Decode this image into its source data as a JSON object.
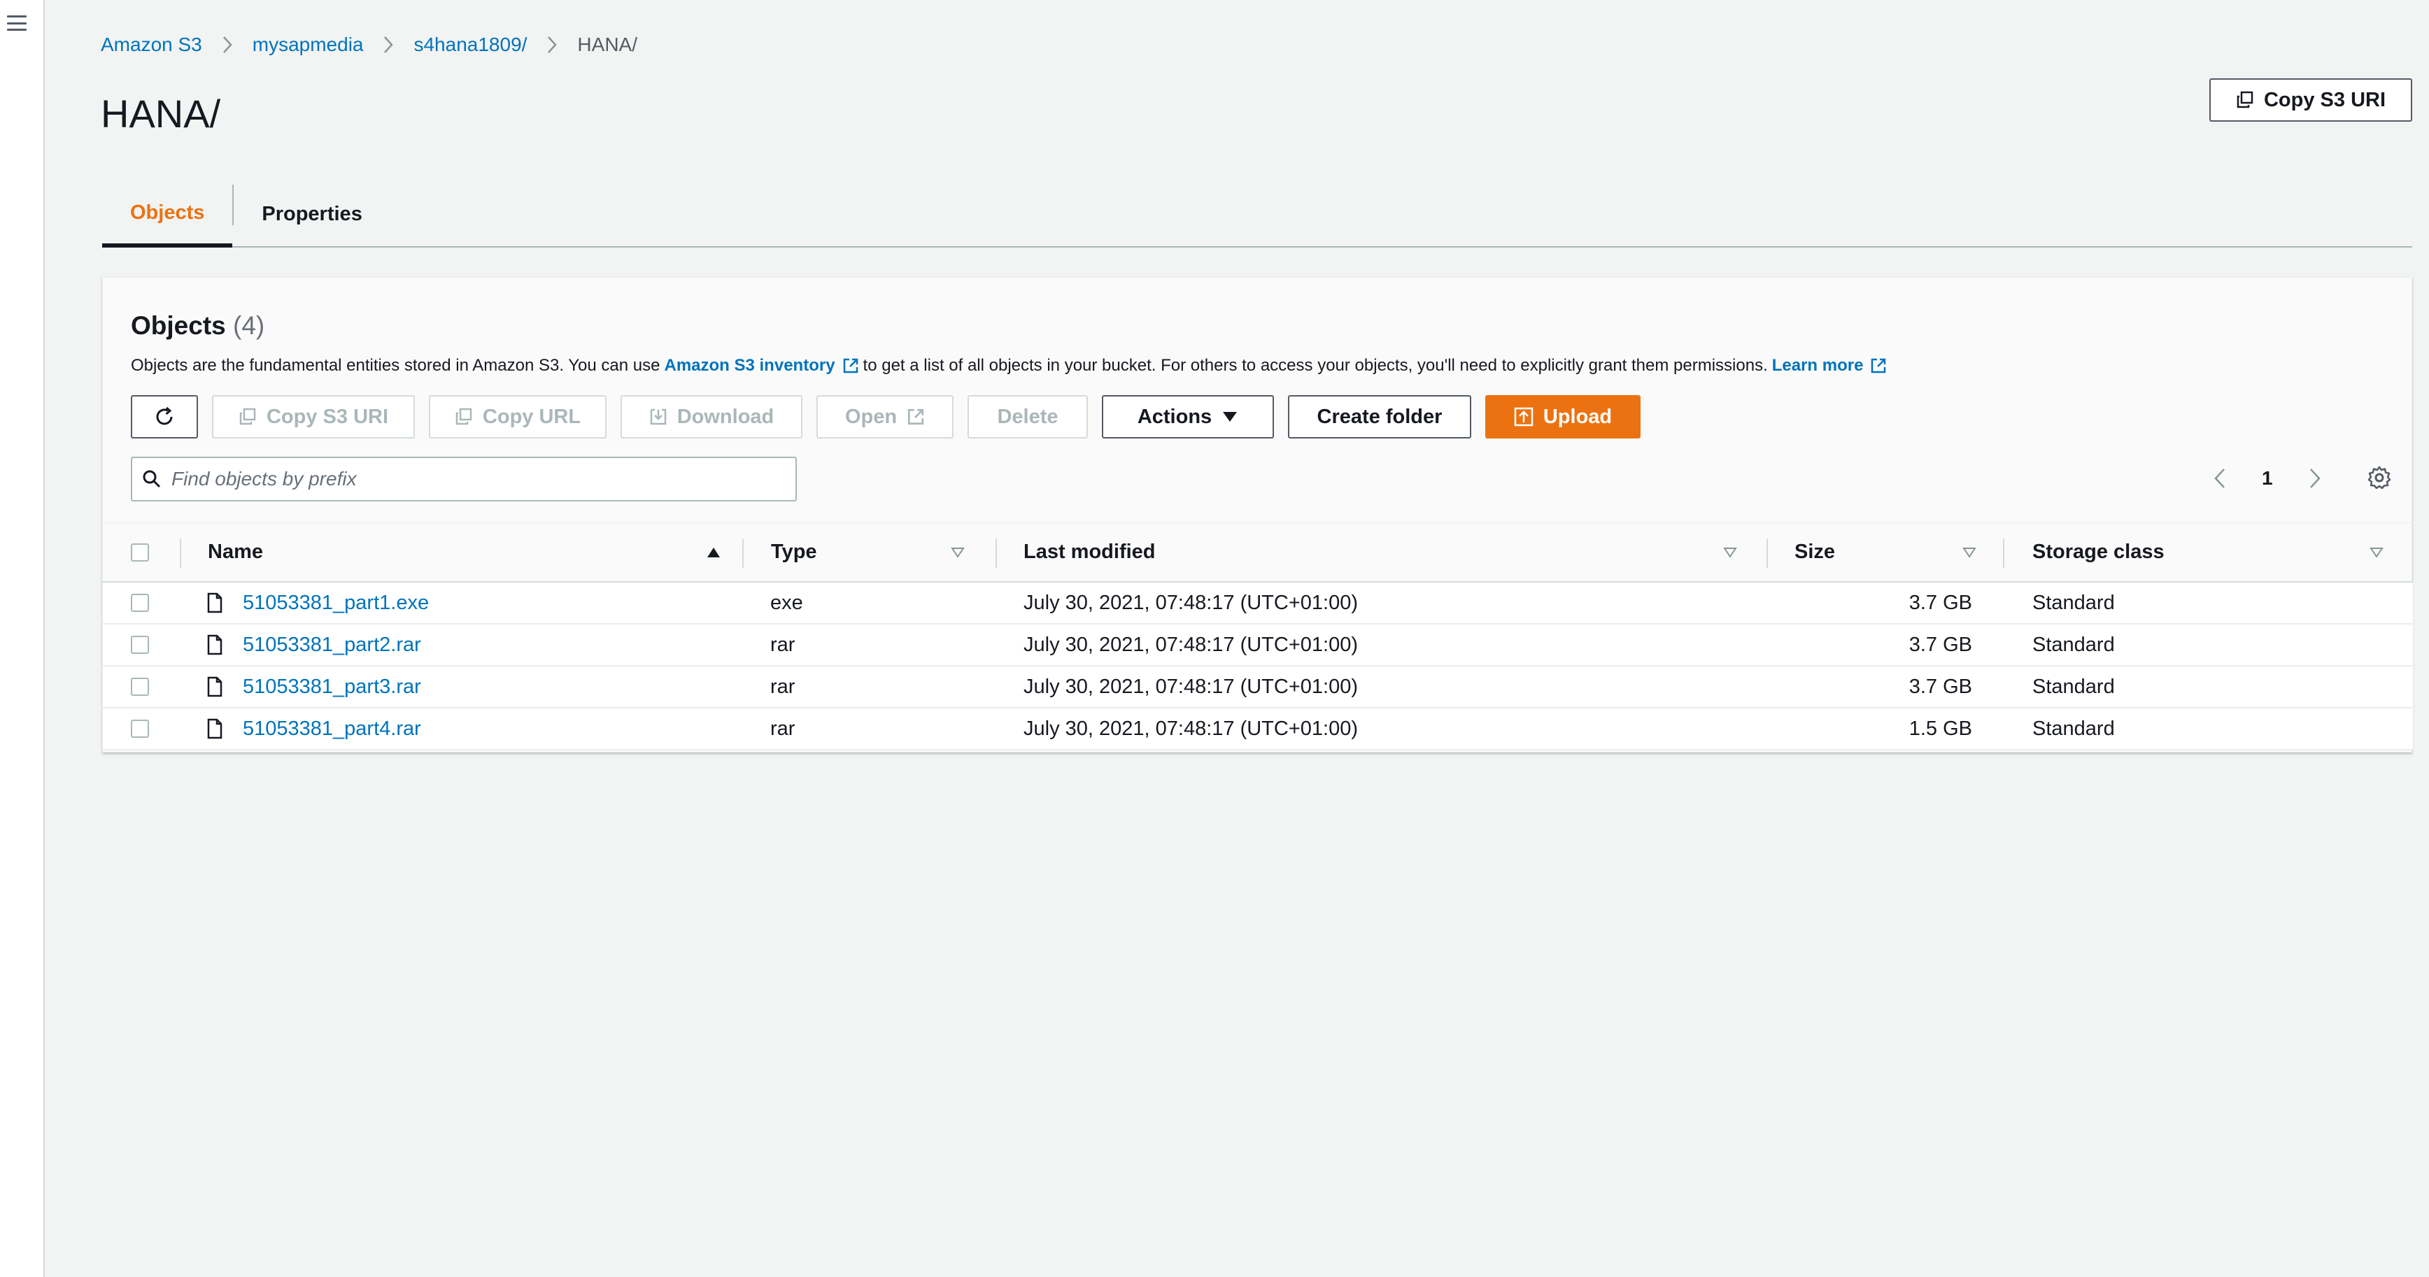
{
  "breadcrumb": [
    {
      "label": "Amazon S3"
    },
    {
      "label": "mysapmedia"
    },
    {
      "label": "s4hana1809/"
    },
    {
      "label": "HANA/"
    }
  ],
  "page": {
    "title": "HANA/",
    "copy_uri_label": "Copy S3 URI"
  },
  "tabs": [
    {
      "label": "Objects",
      "active": true
    },
    {
      "label": "Properties",
      "active": false
    }
  ],
  "objects_panel": {
    "title": "Objects",
    "count": "(4)",
    "description_part1": "Objects are the fundamental entities stored in Amazon S3. You can use",
    "inventory_link": "Amazon S3 inventory",
    "description_part2": "to get a list of all objects in your bucket. For others to access your objects, you'll need to explicitly grant them permissions.",
    "learn_more": "Learn more"
  },
  "toolbar": {
    "copy_s3_uri": "Copy S3 URI",
    "copy_url": "Copy URL",
    "download": "Download",
    "open": "Open",
    "delete": "Delete",
    "actions": "Actions",
    "create_folder": "Create folder",
    "upload": "Upload"
  },
  "search": {
    "placeholder": "Find objects by prefix",
    "value": ""
  },
  "pagination": {
    "current_page": "1"
  },
  "table": {
    "columns": [
      "Name",
      "Type",
      "Last modified",
      "Size",
      "Storage class"
    ],
    "rows": [
      {
        "name": "51053381_part1.exe",
        "type": "exe",
        "last_modified": "July 30, 2021, 07:48:17 (UTC+01:00)",
        "size": "3.7 GB",
        "storage_class": "Standard"
      },
      {
        "name": "51053381_part2.rar",
        "type": "rar",
        "last_modified": "July 30, 2021, 07:48:17 (UTC+01:00)",
        "size": "3.7 GB",
        "storage_class": "Standard"
      },
      {
        "name": "51053381_part3.rar",
        "type": "rar",
        "last_modified": "July 30, 2021, 07:48:17 (UTC+01:00)",
        "size": "3.7 GB",
        "storage_class": "Standard"
      },
      {
        "name": "51053381_part4.rar",
        "type": "rar",
        "last_modified": "July 30, 2021, 07:48:17 (UTC+01:00)",
        "size": "1.5 GB",
        "storage_class": "Standard"
      }
    ]
  },
  "colors": {
    "link": "#0073bb",
    "accent_orange": "#ec7211",
    "text": "#16191f",
    "disabled": "#aab7b8",
    "background": "#f2f3f3"
  },
  "icons": [
    "menu-icon",
    "chevron-right-icon",
    "copy-icon",
    "refresh-icon",
    "download-icon",
    "external-link-icon",
    "caret-down-icon",
    "upload-icon",
    "search-icon",
    "chevron-left-icon",
    "gear-icon",
    "sort-ascending-icon",
    "sort-icon",
    "file-icon"
  ]
}
